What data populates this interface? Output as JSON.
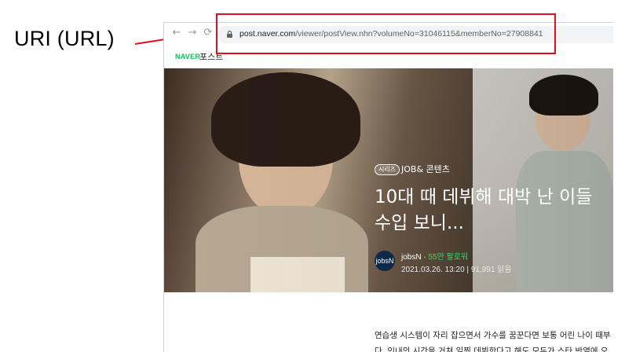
{
  "annotation": {
    "label": "URI (URL)",
    "highlight_color": "#e0101a"
  },
  "browser": {
    "back_icon": "arrow-left-icon",
    "forward_icon": "arrow-right-icon",
    "reload_icon": "reload-icon",
    "lock_icon": "lock-icon",
    "url_host": "post.naver.com",
    "url_path": "/viewer/postView.nhn?volumeNo=31046115&memberNo=27908841"
  },
  "site": {
    "logo": "NAVER",
    "section": "포스트",
    "brand_color": "#03c75a"
  },
  "post": {
    "badge": "시리즈",
    "series": "JOB& 콘텐츠",
    "headline_line1": "10대 때 데뷔해 대박 난 이들",
    "headline_line2": "수입 보니...",
    "avatar_text": "jobsN",
    "author": "jobsN",
    "separator": " · ",
    "followers": "55만 팔로워",
    "date": "2021.03.26. 13:20",
    "views": "91,991 읽음",
    "body_line1": "연습생 시스템이 자리 잡으면서 가수를 꿈꾼다면 보통 어린 나이 때부",
    "body_line2": "다. 인내의 시간을 거쳐 일찍 데뷔한다고 해도 모두가 스타 반열에 오"
  }
}
